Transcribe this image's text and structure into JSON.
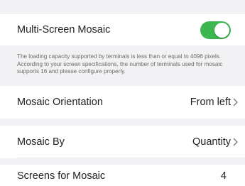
{
  "mosaic": {
    "label": "Multi-Screen Mosaic",
    "enabled": true,
    "toggle_color": "#3cb64f"
  },
  "note": {
    "text": "The loading capacity supported by terminals is less than or equal to 4096 pixels. According to your screen specifications, the number of terminals used for mosaic supports 16 and please configure properly."
  },
  "orientation": {
    "label": "Mosaic Orientation",
    "value": "From left"
  },
  "mosaic_by": {
    "label": "Mosaic By",
    "value": "Quantity"
  },
  "screens": {
    "label": "Screens for Mosaic",
    "value": "4"
  },
  "icons": {
    "chevron": "chevron-right-icon"
  }
}
